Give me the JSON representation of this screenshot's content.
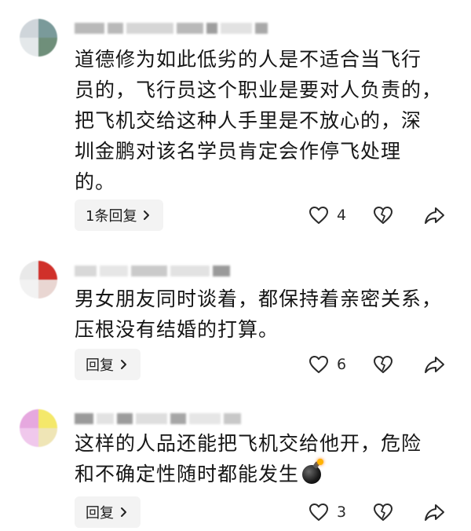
{
  "comments": [
    {
      "avatar_colors": [
        "#cfd5da",
        "#7a9a9a",
        "#e4e8ea",
        "#6f8f7a"
      ],
      "username_block_color": "#b9b9b9",
      "text": "道德修为如此低劣的人是不适合当飞行\n员的，飞行员这个职业是要对人负责的，\n把飞机交给这种人手里是不放心的，深\n圳金鹏对该名学员肯定会作停飞处理\n的。",
      "reply_label": "1条回复",
      "like_count": "4",
      "icons": {
        "like": "heart-icon",
        "dislike": "broken-heart-icon",
        "share": "share-arrow-icon",
        "reply": "chevron-right-icon"
      }
    },
    {
      "avatar_colors": [
        "#e9e9e9",
        "#d0302a",
        "#f2f2f2",
        "#e9d6d2"
      ],
      "username_block_color": "#b9b9b9",
      "text": "男女朋友同时谈着，都保持着亲密关系，\n压根没有结婚的打算。",
      "reply_label": "回复",
      "like_count": "6",
      "icons": {
        "like": "heart-icon",
        "dislike": "broken-heart-icon",
        "share": "share-arrow-icon",
        "reply": "chevron-right-icon"
      }
    },
    {
      "avatar_colors": [
        "#e6a8df",
        "#f4e86a",
        "#f0c8ec",
        "#efe5b6"
      ],
      "username_block_color": "#b9b9b9",
      "text": "这样的人品还能把飞机交给他开，危险\n和不确定性随时都能发生",
      "emoji": "bomb-emoji",
      "reply_label": "回复",
      "like_count": "3",
      "icons": {
        "like": "heart-icon",
        "dislike": "broken-heart-icon",
        "share": "share-arrow-icon",
        "reply": "chevron-right-icon"
      }
    }
  ]
}
